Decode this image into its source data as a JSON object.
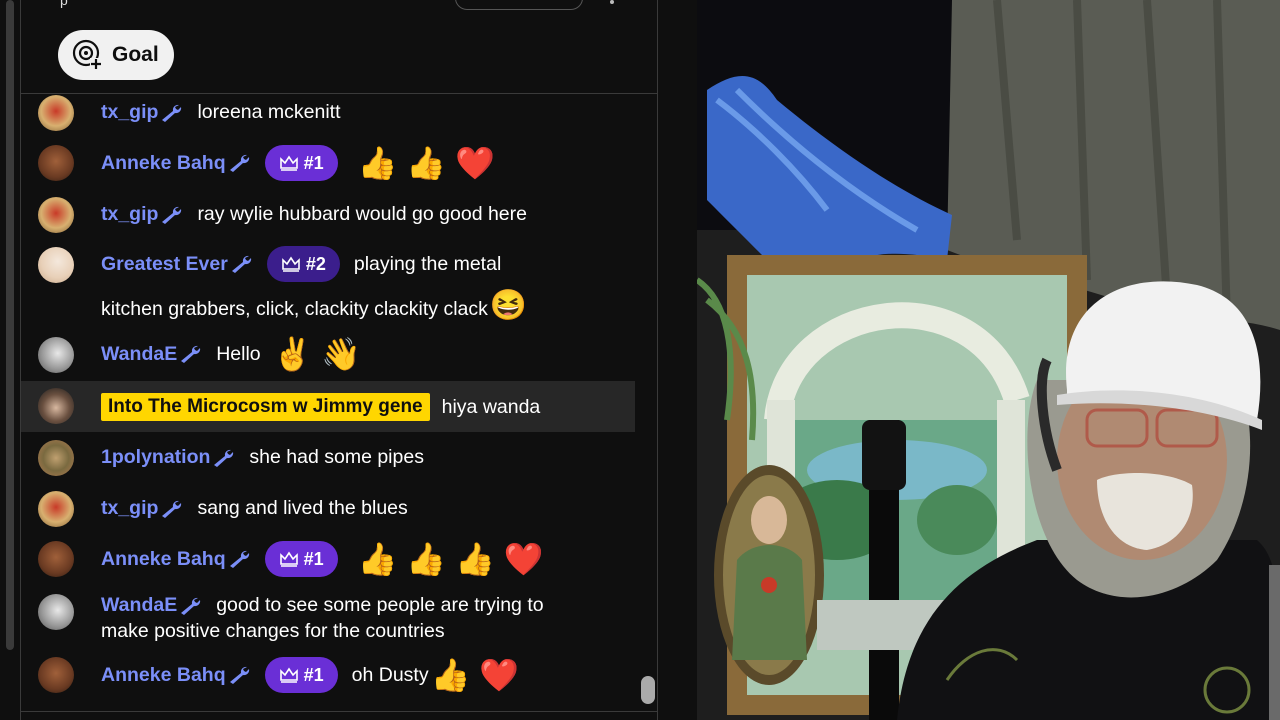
{
  "header": {
    "partial_title": "p"
  },
  "goal_button": {
    "label": "Goal"
  },
  "messages": [
    {
      "author": "tx_gip",
      "text": "loreena mckenitt"
    },
    {
      "author": "Anneke Bahq",
      "badge": "#1",
      "emojis": "👍 👍 ❤️"
    },
    {
      "author": "tx_gip",
      "text": "ray wylie hubbard would go good here"
    },
    {
      "author": "Greatest Ever",
      "badge": "#2",
      "text": "playing the metal",
      "text2": "kitchen grabbers, click, clackity clackity clack",
      "emoji": "😆"
    },
    {
      "author": "WandaE",
      "text": "Hello",
      "emojis": "✌️ 👋"
    },
    {
      "author": "Into The Microcosm w Jimmy gene",
      "text": "hiya wanda"
    },
    {
      "author": "1polynation",
      "text": "she had some pipes"
    },
    {
      "author": "tx_gip",
      "text": "sang and lived the blues"
    },
    {
      "author": "Anneke Bahq",
      "badge": "#1",
      "emojis": "👍 👍 👍 ❤️"
    },
    {
      "author": "WandaE",
      "text": "good to see some people are trying to",
      "text2": "make positive changes for the countries"
    },
    {
      "author": "Anneke Bahq",
      "badge": "#1",
      "text": "oh Dusty",
      "emojis": "👍 ❤️"
    }
  ],
  "colors": {
    "name": "#7b8ff8",
    "owner_chip": "#ffd600",
    "badge_1": "#6a2fd6",
    "badge_2": "#3b1e8c"
  }
}
